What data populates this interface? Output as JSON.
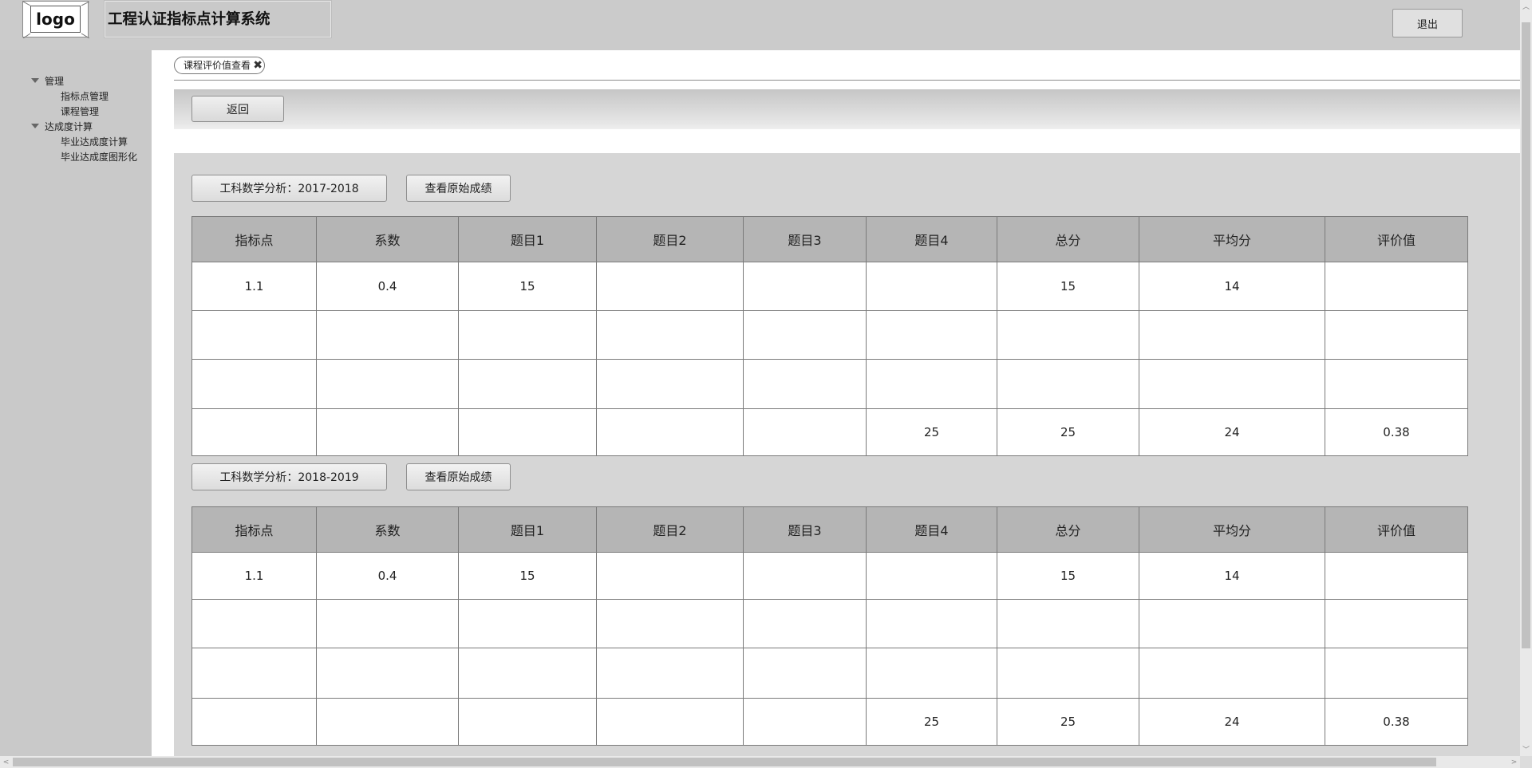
{
  "header": {
    "logo_text": "logo",
    "system_title": "工程认证指标点计算系统",
    "logout_label": "退出"
  },
  "sidebar": {
    "groups": [
      {
        "label": "管理",
        "items": [
          "指标点管理",
          "课程管理"
        ]
      },
      {
        "label": "达成度计算",
        "items": [
          "毕业达成度计算",
          "毕业达成度图形化"
        ]
      }
    ]
  },
  "tabs": [
    {
      "label": "课程评价值查看",
      "close_icon": "close-icon"
    }
  ],
  "toolbar": {
    "back_label": "返回"
  },
  "sections": [
    {
      "course_label": "工科数学分析：2017-2018",
      "view_raw_label": "查看原始成绩",
      "columns": [
        "指标点",
        "系数",
        "题目1",
        "题目2",
        "题目3",
        "题目4",
        "总分",
        "平均分",
        "评价值"
      ],
      "rows": [
        [
          "1.1",
          "0.4",
          "15",
          "",
          "",
          "",
          "15",
          "14",
          ""
        ],
        [
          "",
          "",
          "",
          "",
          "",
          "",
          "",
          "",
          ""
        ],
        [
          "",
          "",
          "",
          "",
          "",
          "",
          "",
          "",
          ""
        ],
        [
          "",
          "",
          "",
          "",
          "",
          "25",
          "25",
          "24",
          "0.38"
        ]
      ]
    },
    {
      "course_label": "工科数学分析：2018-2019",
      "view_raw_label": "查看原始成绩",
      "columns": [
        "指标点",
        "系数",
        "题目1",
        "题目2",
        "题目3",
        "题目4",
        "总分",
        "平均分",
        "评价值"
      ],
      "rows": [
        [
          "1.1",
          "0.4",
          "15",
          "",
          "",
          "",
          "15",
          "14",
          ""
        ],
        [
          "",
          "",
          "",
          "",
          "",
          "",
          "",
          "",
          ""
        ],
        [
          "",
          "",
          "",
          "",
          "",
          "",
          "",
          "",
          ""
        ],
        [
          "",
          "",
          "",
          "",
          "",
          "25",
          "25",
          "24",
          "0.38"
        ]
      ]
    }
  ]
}
